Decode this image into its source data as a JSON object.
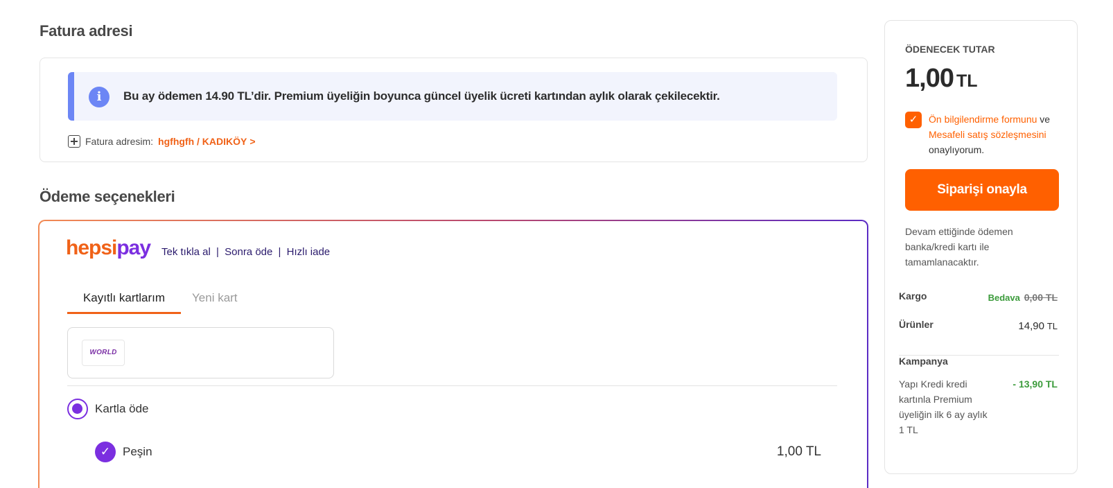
{
  "billing": {
    "section_title": "Fatura adresi",
    "info_message": "Bu ay ödemen 14.90 TL’dir. Premium üyeliğin boyunca güncel üyelik ücreti kartından aylık olarak çekilecektir.",
    "info_icon": "info-icon",
    "address_label": "Fatura adresim:",
    "address_value": "hgfhgfh / KADIKÖY",
    "chevron": ">"
  },
  "payment": {
    "section_title": "Ödeme seçenekleri",
    "logo_hepsi": "hepsi",
    "logo_pay": "pay",
    "tagline": [
      "Tek tıkla al",
      "Sonra öde",
      "Hızlı iade"
    ],
    "tagline_separator": "|",
    "tabs": [
      {
        "label": "Kayıtlı kartlarım",
        "active": true
      },
      {
        "label": "Yeni kart",
        "active": false
      }
    ],
    "card_brand": "WORLD",
    "option_label": "Kartla öde",
    "installment_label": "Peşin",
    "installment_amount": "1,00 TL"
  },
  "summary": {
    "title": "ÖDENECEK TUTAR",
    "amount": "1,00",
    "currency": "TL",
    "agreement": {
      "link1": "Ön bilgilendirme formunu",
      "and": " ve ",
      "link2": "Mesafeli satış sözleşmesini",
      "suffix": " onaylıyorum."
    },
    "confirm_button": "Siparişi onayla",
    "note": "Devam ettiğinde ödemen banka/kredi kartı ile tamamlanacaktır.",
    "cargo_label": "Kargo",
    "cargo_free": "Bedava",
    "cargo_old": "0,00 TL",
    "products_label": "Ürünler",
    "products_value": "14,90",
    "products_currency": "TL",
    "campaign_label": "Kampanya",
    "campaign_desc": "Yapı Kredi kredi kartınla Premium üyeliğin ilk 6 ay aylık 1 TL",
    "campaign_discount": "- 13,90 TL"
  },
  "colors": {
    "accent_orange": "#ff6000",
    "brand_purple": "#7b2fe0",
    "info_blue": "#6c86f5",
    "discount_green": "#3b9b3b"
  }
}
